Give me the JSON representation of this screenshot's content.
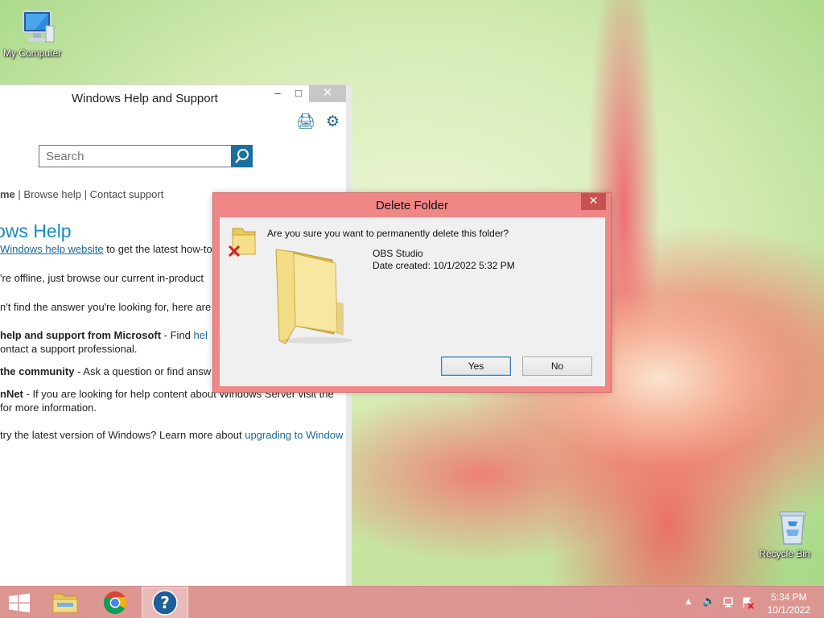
{
  "desktop": {
    "icons": [
      {
        "label": "My Computer",
        "icon": "computer-icon"
      },
      {
        "label": "Recycle Bin",
        "icon": "recycle-bin-icon"
      }
    ]
  },
  "help_window": {
    "title": "Windows Help and Support",
    "controls": {
      "minimize": "–",
      "maximize": "□",
      "close": "✕"
    },
    "toolbar": [
      {
        "icon": "print-icon",
        "glyph": "🖨"
      },
      {
        "icon": "gear-icon",
        "glyph": "⚙"
      }
    ],
    "search_placeholder": "Search",
    "nav": {
      "home": "me",
      "sep1": " | ",
      "browse": "Browse help",
      "sep2": " | ",
      "contact": "Contact support"
    },
    "heading": "ows Help",
    "lines": {
      "l1_link": "Windows help website",
      "l1_text": " to get the latest how-to",
      "l2": "'re offline, just browse our current in-product",
      "l3": "n't find the answer you're looking for, here are",
      "l4_bold": "help and support from Microsoft",
      "l4_dash": " - Find ",
      "l4_link": "hel",
      "l5": "ontact a support professional.",
      "l6_bold": "the community",
      "l6_text": " - Ask a question or find answ",
      "l7_bold": "nNet",
      "l7_text": " - If you are looking for help content about Windows Server visit the",
      "l8": "for more information.",
      "l9_text": " try the latest version of Windows? Learn more about ",
      "l9_link": "upgrading to Window"
    }
  },
  "dialog": {
    "title": "Delete Folder",
    "close": "✕",
    "question": "Are you sure you want to permanently delete this folder?",
    "folder_name": "OBS Studio",
    "date_created": "Date created: 10/1/2022 5:32 PM",
    "yes_label": "Yes",
    "no_label": "No"
  },
  "taskbar": {
    "items": [
      "start-button",
      "file-explorer",
      "chrome",
      "help-and-support"
    ],
    "tray": {
      "show_hidden": "▲",
      "volume": "🔈"
    },
    "time": "5:34 PM",
    "date": "10/1/2022"
  },
  "colors": {
    "dialog_frame": "#f08686",
    "taskbar": "#de9292",
    "accent": "#1a6896",
    "help_heading": "#1a8abf"
  }
}
